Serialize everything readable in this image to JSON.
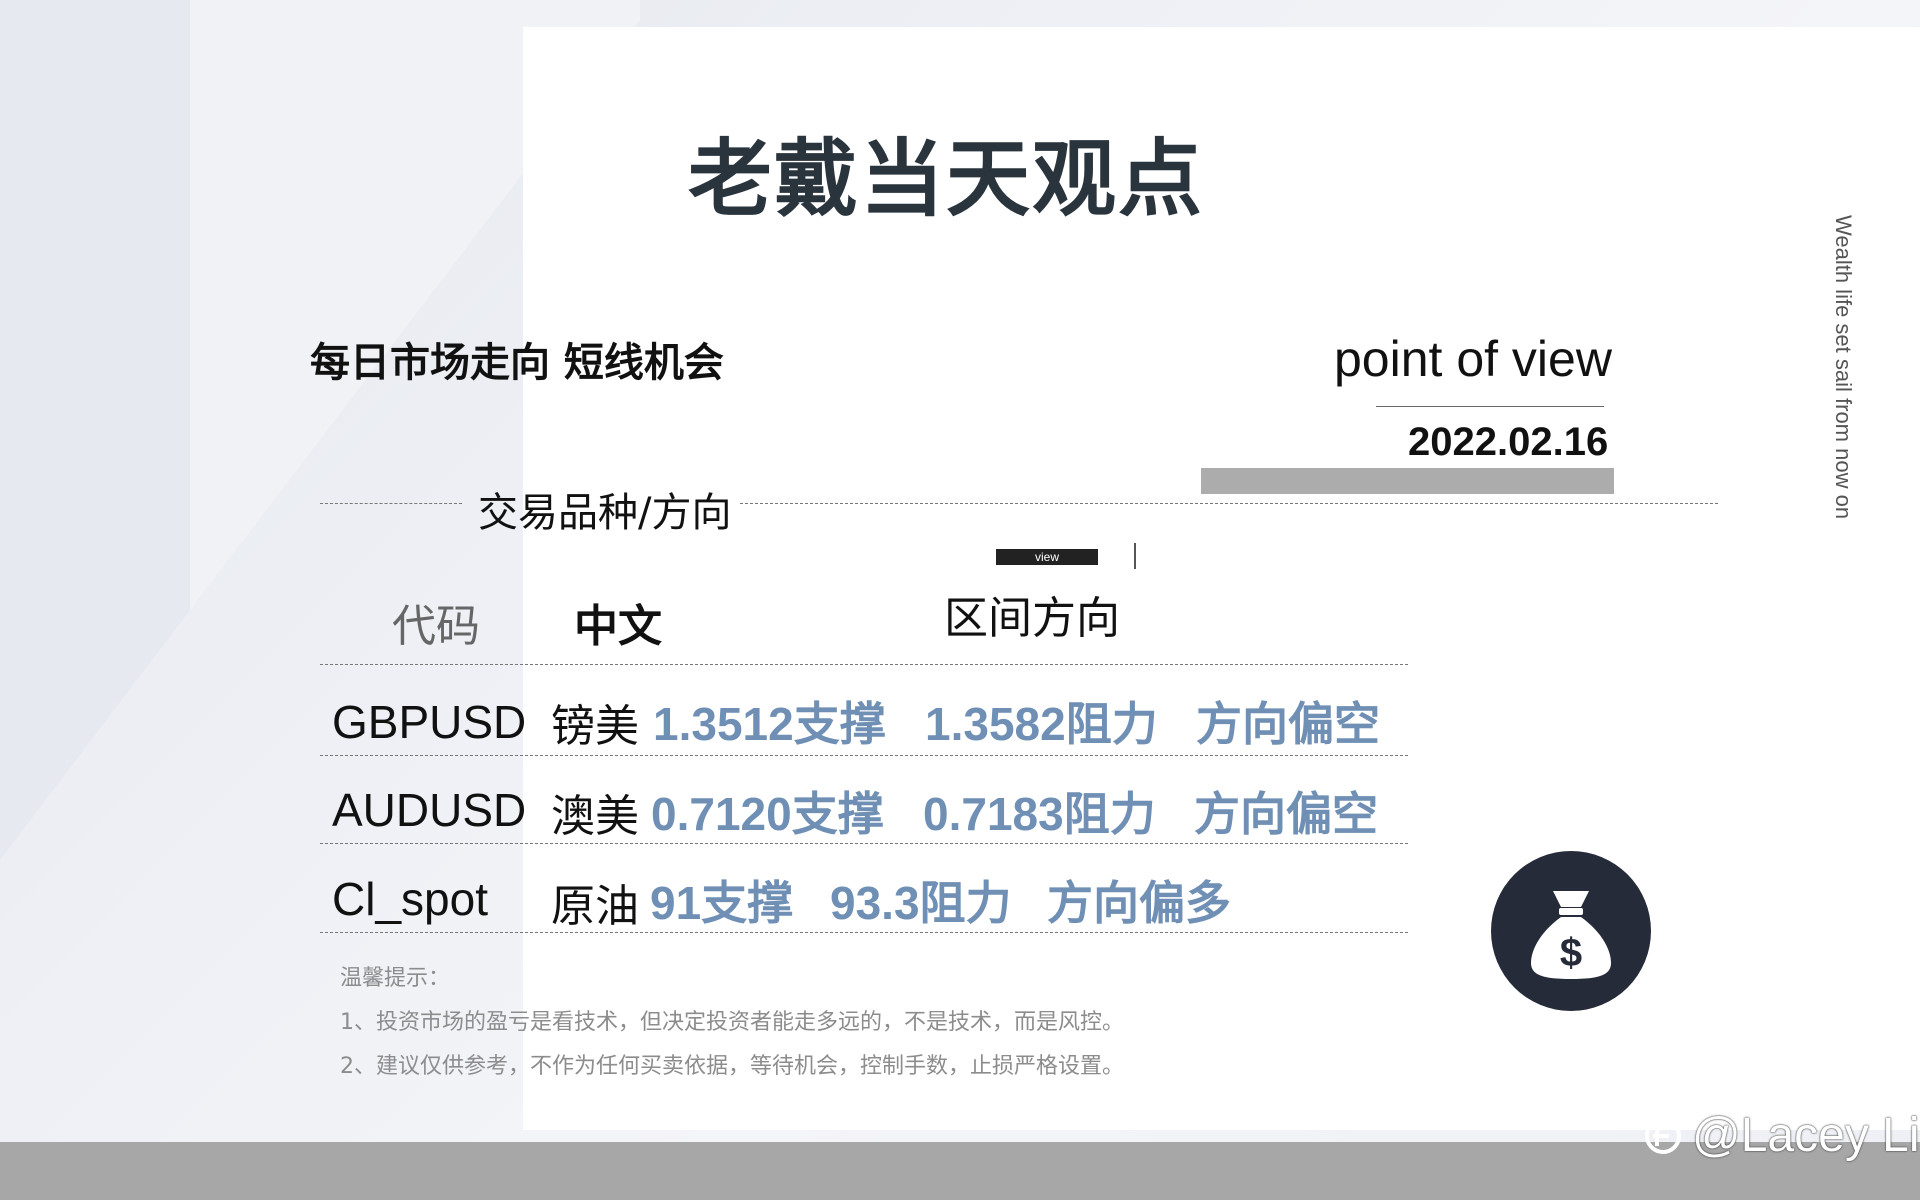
{
  "title": "老戴当天观点",
  "subtitle": "每日市场走向 短线机会",
  "point_of_view": "point of view",
  "date": "2022.02.16",
  "vertical_text": "Wealth life set sail from now on",
  "section_label": "交易品种/方向",
  "view_tag": "view",
  "columns": {
    "code": "代码",
    "chinese": "中文",
    "range_direction": "区间方向"
  },
  "rows": [
    {
      "code": "GBPUSD",
      "name": "镑美",
      "support": "1.3512支撑",
      "resistance": "1.3582阻力",
      "direction": "方向偏空"
    },
    {
      "code": "AUDUSD",
      "name": "澳美",
      "support": "0.7120支撑",
      "resistance": "0.7183阻力",
      "direction": "方向偏空"
    },
    {
      "code": "Cl_spot",
      "name": "原油",
      "support": "91支撑",
      "resistance": "93.3阻力",
      "direction": "方向偏多"
    }
  ],
  "tips": {
    "heading": "温馨提示：",
    "line1": "1、投资市场的盈亏是看技术，但决定投资者能走多远的，不是技术，而是风控。",
    "line2": "2、建议仅供参考，不作为任何买卖依据，等待机会，控制手数，止损严格设置。"
  },
  "icon": "money-bag-icon",
  "watermark": "@Lacey Li",
  "colors": {
    "value_blue": "#6f8fb5",
    "title": "#2a343d",
    "icon_circle": "#262b3a"
  }
}
